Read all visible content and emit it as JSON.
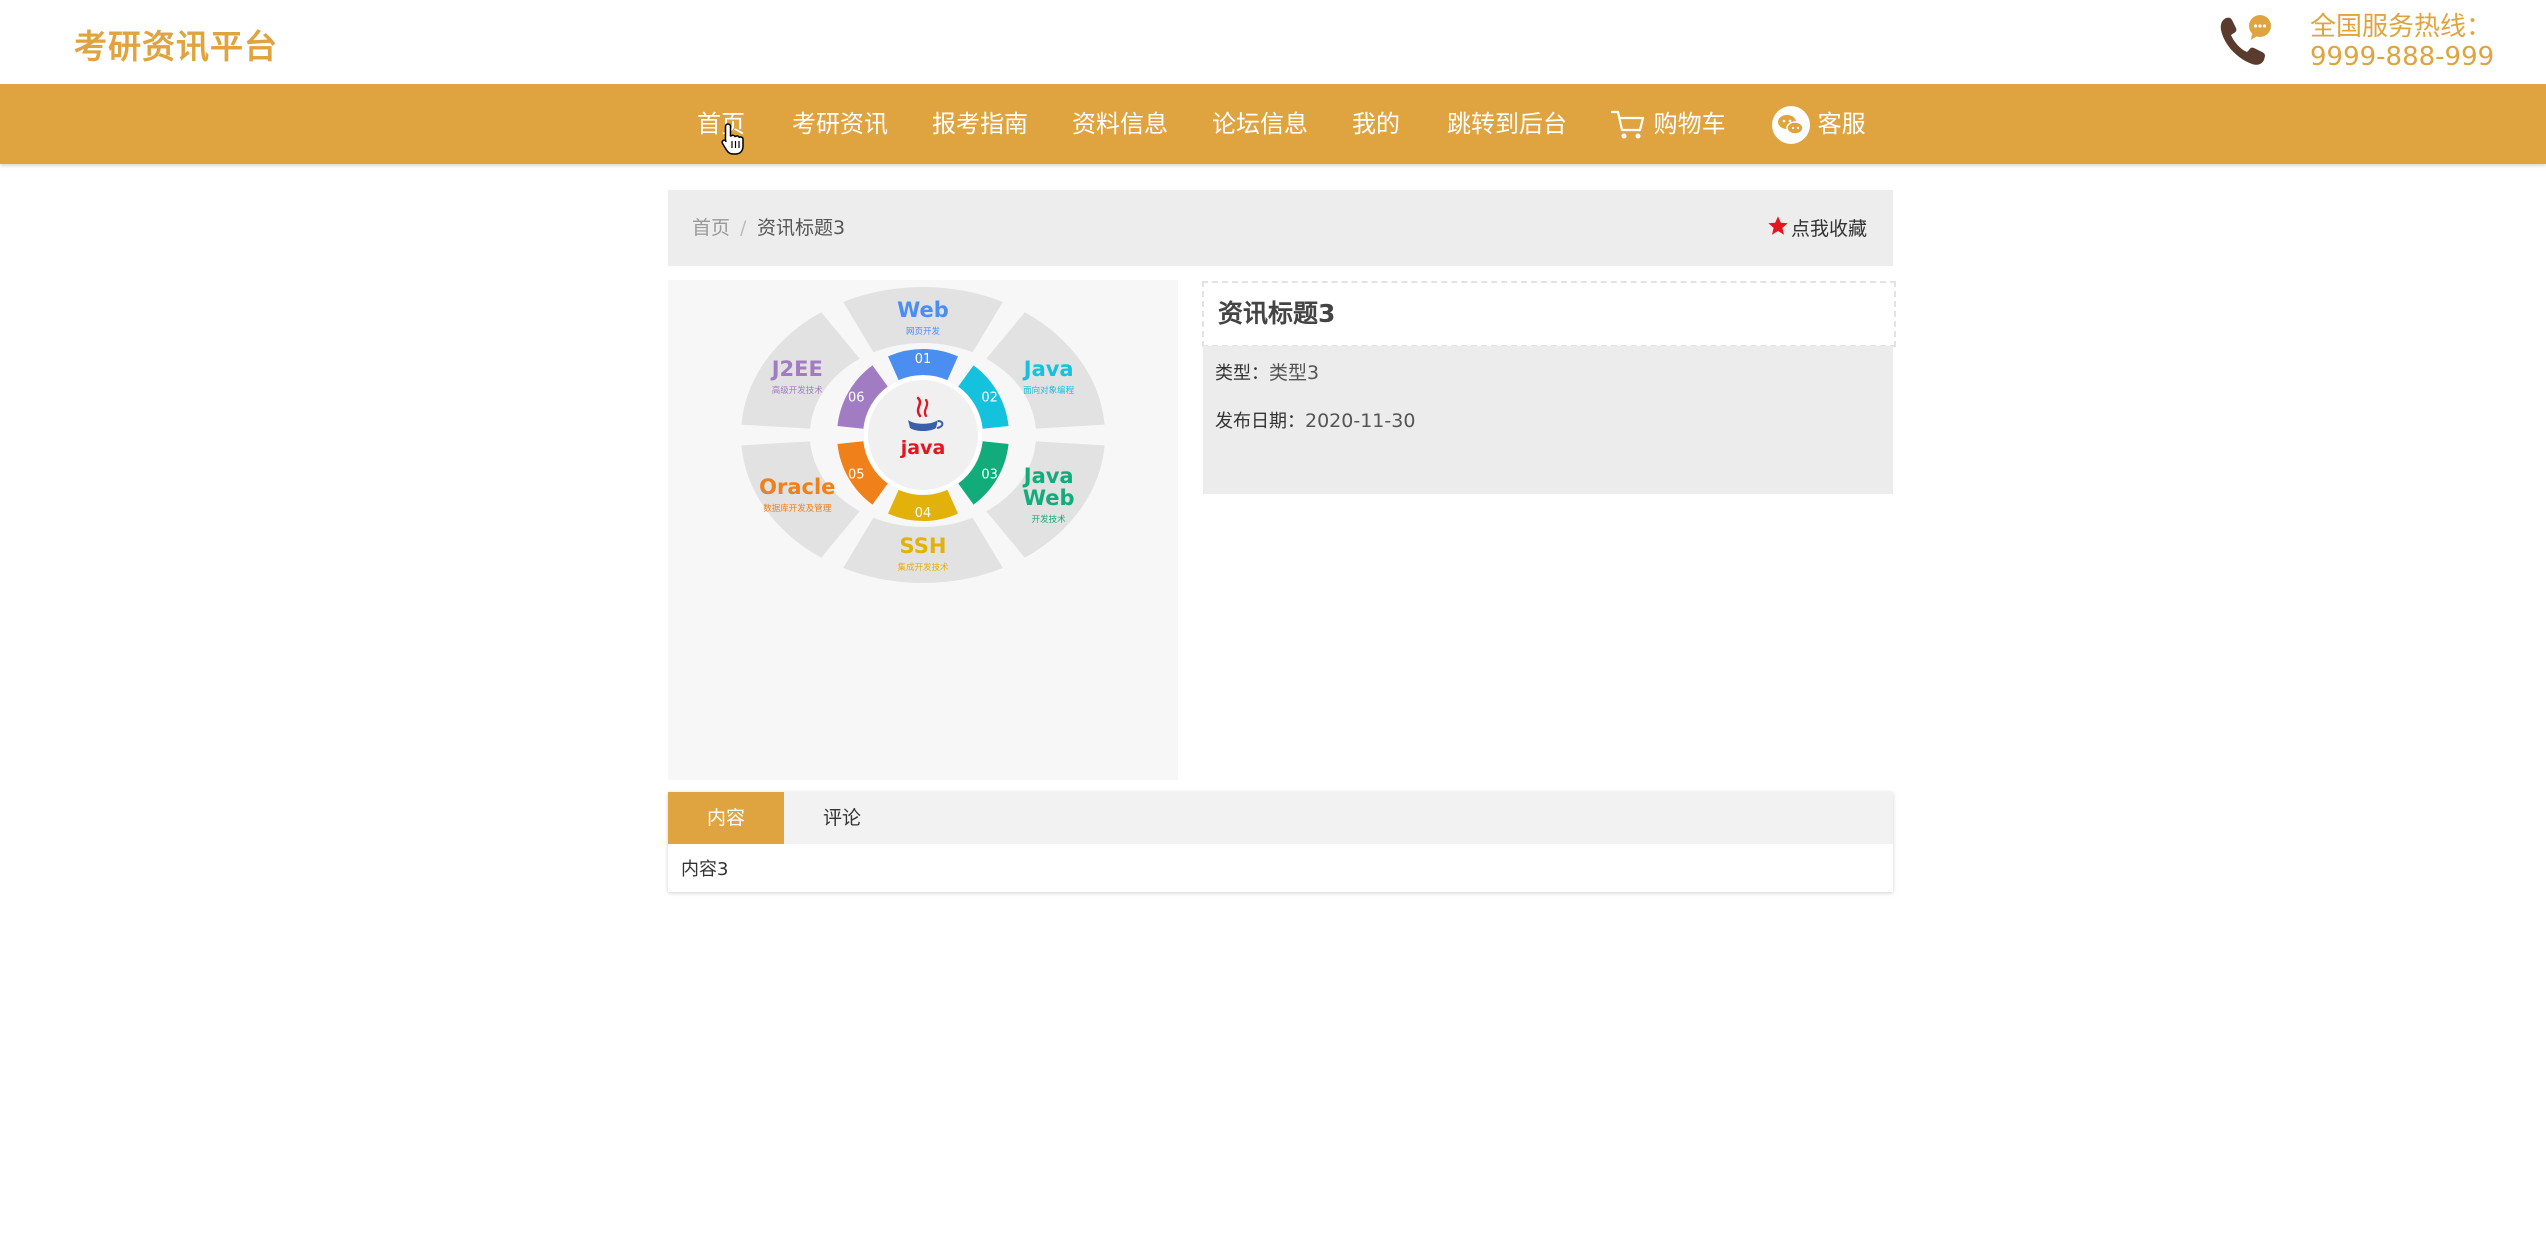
{
  "header": {
    "brand": "考研资讯平台",
    "hotline_label": "全国服务热线：",
    "hotline_number": "9999-888-999"
  },
  "nav": {
    "home": "首页",
    "news": "考研资讯",
    "guide": "报考指南",
    "materials": "资料信息",
    "forum": "论坛信息",
    "mine": "我的",
    "admin": "跳转到后台",
    "cart": "购物车",
    "service": "客服"
  },
  "breadcrumb": {
    "home": "首页",
    "separator": "/",
    "current": "资讯标题3"
  },
  "favorite": {
    "label": "点我收藏"
  },
  "image": {
    "segments": [
      {
        "num": "01",
        "title": "Web",
        "sub": "网页开发",
        "color": "#4a8ff0"
      },
      {
        "num": "02",
        "title": "Java",
        "sub": "面向对象编程",
        "color": "#14c2de"
      },
      {
        "num": "03",
        "title": "Java Web",
        "sub": "开发技术",
        "color": "#12ab7a"
      },
      {
        "num": "04",
        "title": "SSH",
        "sub": "集成开发技术",
        "color": "#e2b10a"
      },
      {
        "num": "05",
        "title": "Oracle",
        "sub": "数据库开发及管理",
        "color": "#f0801a"
      },
      {
        "num": "06",
        "title": "J2EE",
        "sub": "高级开发技术",
        "color": "#a27cc2"
      }
    ],
    "center_label": "java"
  },
  "article": {
    "title": "资讯标题3",
    "type_label": "类型：",
    "type_value": "类型3",
    "date_label": "发布日期：",
    "date_value": "2020-11-30"
  },
  "tabs": {
    "content_label": "内容",
    "comment_label": "评论",
    "content_text": "内容3"
  },
  "colors": {
    "accent": "#dfa43f",
    "phone": "#5b3b2e",
    "star": "#e4151f"
  }
}
